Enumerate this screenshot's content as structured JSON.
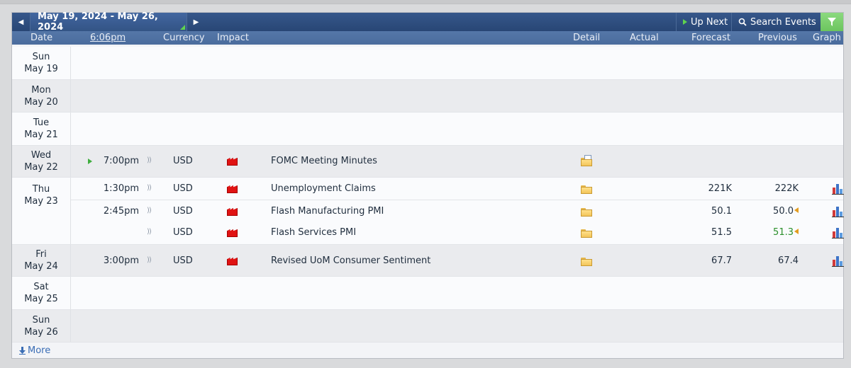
{
  "nav": {
    "prev_icon": "◀",
    "date_range": "May 19, 2024 - May 26, 2024",
    "next_icon": "▶",
    "up_next": "Up Next",
    "search_events": "Search Events",
    "filter_icon": "filter-icon"
  },
  "headers": {
    "date": "Date",
    "time": "6:06pm",
    "currency": "Currency",
    "impact": "Impact",
    "detail": "Detail",
    "actual": "Actual",
    "forecast": "Forecast",
    "previous": "Previous",
    "graph": "Graph"
  },
  "days": [
    {
      "dow": "Sun",
      "date": "May 19"
    },
    {
      "dow": "Mon",
      "date": "May 20"
    },
    {
      "dow": "Tue",
      "date": "May 21"
    },
    {
      "dow": "Wed",
      "date": "May 22"
    },
    {
      "dow": "Thu",
      "date": "May 23"
    },
    {
      "dow": "Fri",
      "date": "May 24"
    },
    {
      "dow": "Sat",
      "date": "May 25"
    },
    {
      "dow": "Sun",
      "date": "May 26"
    }
  ],
  "events": [
    {
      "time": "7:00pm",
      "currency": "USD",
      "impact": "high",
      "title": "FOMC Meeting Minutes",
      "actual": "",
      "forecast": "",
      "previous": ""
    },
    {
      "time": "1:30pm",
      "currency": "USD",
      "impact": "high",
      "title": "Unemployment Claims",
      "actual": "",
      "forecast": "221K",
      "previous": "222K"
    },
    {
      "time": "2:45pm",
      "currency": "USD",
      "impact": "high",
      "title": "Flash Manufacturing PMI",
      "actual": "",
      "forecast": "50.1",
      "previous": "50.0"
    },
    {
      "time": "",
      "currency": "USD",
      "impact": "high",
      "title": "Flash Services PMI",
      "actual": "",
      "forecast": "51.5",
      "previous": "51.3"
    },
    {
      "time": "3:00pm",
      "currency": "USD",
      "impact": "high",
      "title": "Revised UoM Consumer Sentiment",
      "actual": "",
      "forecast": "67.7",
      "previous": "67.4"
    }
  ],
  "more": "More",
  "colors": {
    "impact_high": "#e01313",
    "nav_bg": "#2c4a7a",
    "filter_active": "#6cc55e",
    "previous_better": "#2a8f2a"
  }
}
